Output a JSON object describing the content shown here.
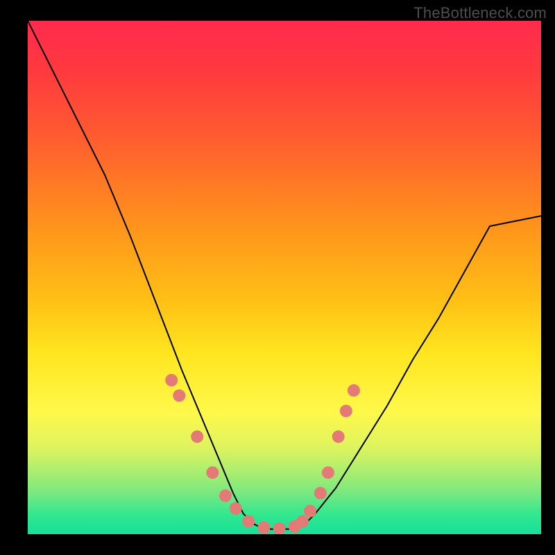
{
  "watermark": "TheBottleneck.com",
  "chart_data": {
    "type": "line",
    "title": "",
    "xlabel": "",
    "ylabel": "",
    "xlim": [
      0,
      100
    ],
    "ylim": [
      0,
      100
    ],
    "curve": {
      "name": "bottleneck-curve",
      "x": [
        0,
        5,
        10,
        15,
        20,
        25,
        30,
        35,
        40,
        42,
        44,
        46,
        48,
        50,
        52,
        54,
        56,
        60,
        65,
        70,
        75,
        80,
        85,
        90,
        95,
        100
      ],
      "y": [
        100,
        90,
        80,
        70,
        58,
        45,
        32,
        20,
        8,
        4,
        2,
        1,
        1,
        1,
        1,
        2,
        4,
        9,
        17,
        25,
        34,
        42,
        51,
        60,
        61,
        62
      ]
    },
    "markers": {
      "name": "sample-points",
      "color": "#e37a75",
      "x": [
        28,
        29.5,
        33,
        36,
        38.5,
        40.5,
        43,
        46,
        49,
        52,
        53.5,
        55,
        57,
        58.5,
        60.5,
        62,
        63.5
      ],
      "y": [
        30,
        27,
        19,
        12,
        7.5,
        5,
        2.5,
        1.3,
        1.1,
        1.5,
        2.5,
        4.5,
        8,
        12,
        19,
        24,
        28
      ]
    }
  }
}
